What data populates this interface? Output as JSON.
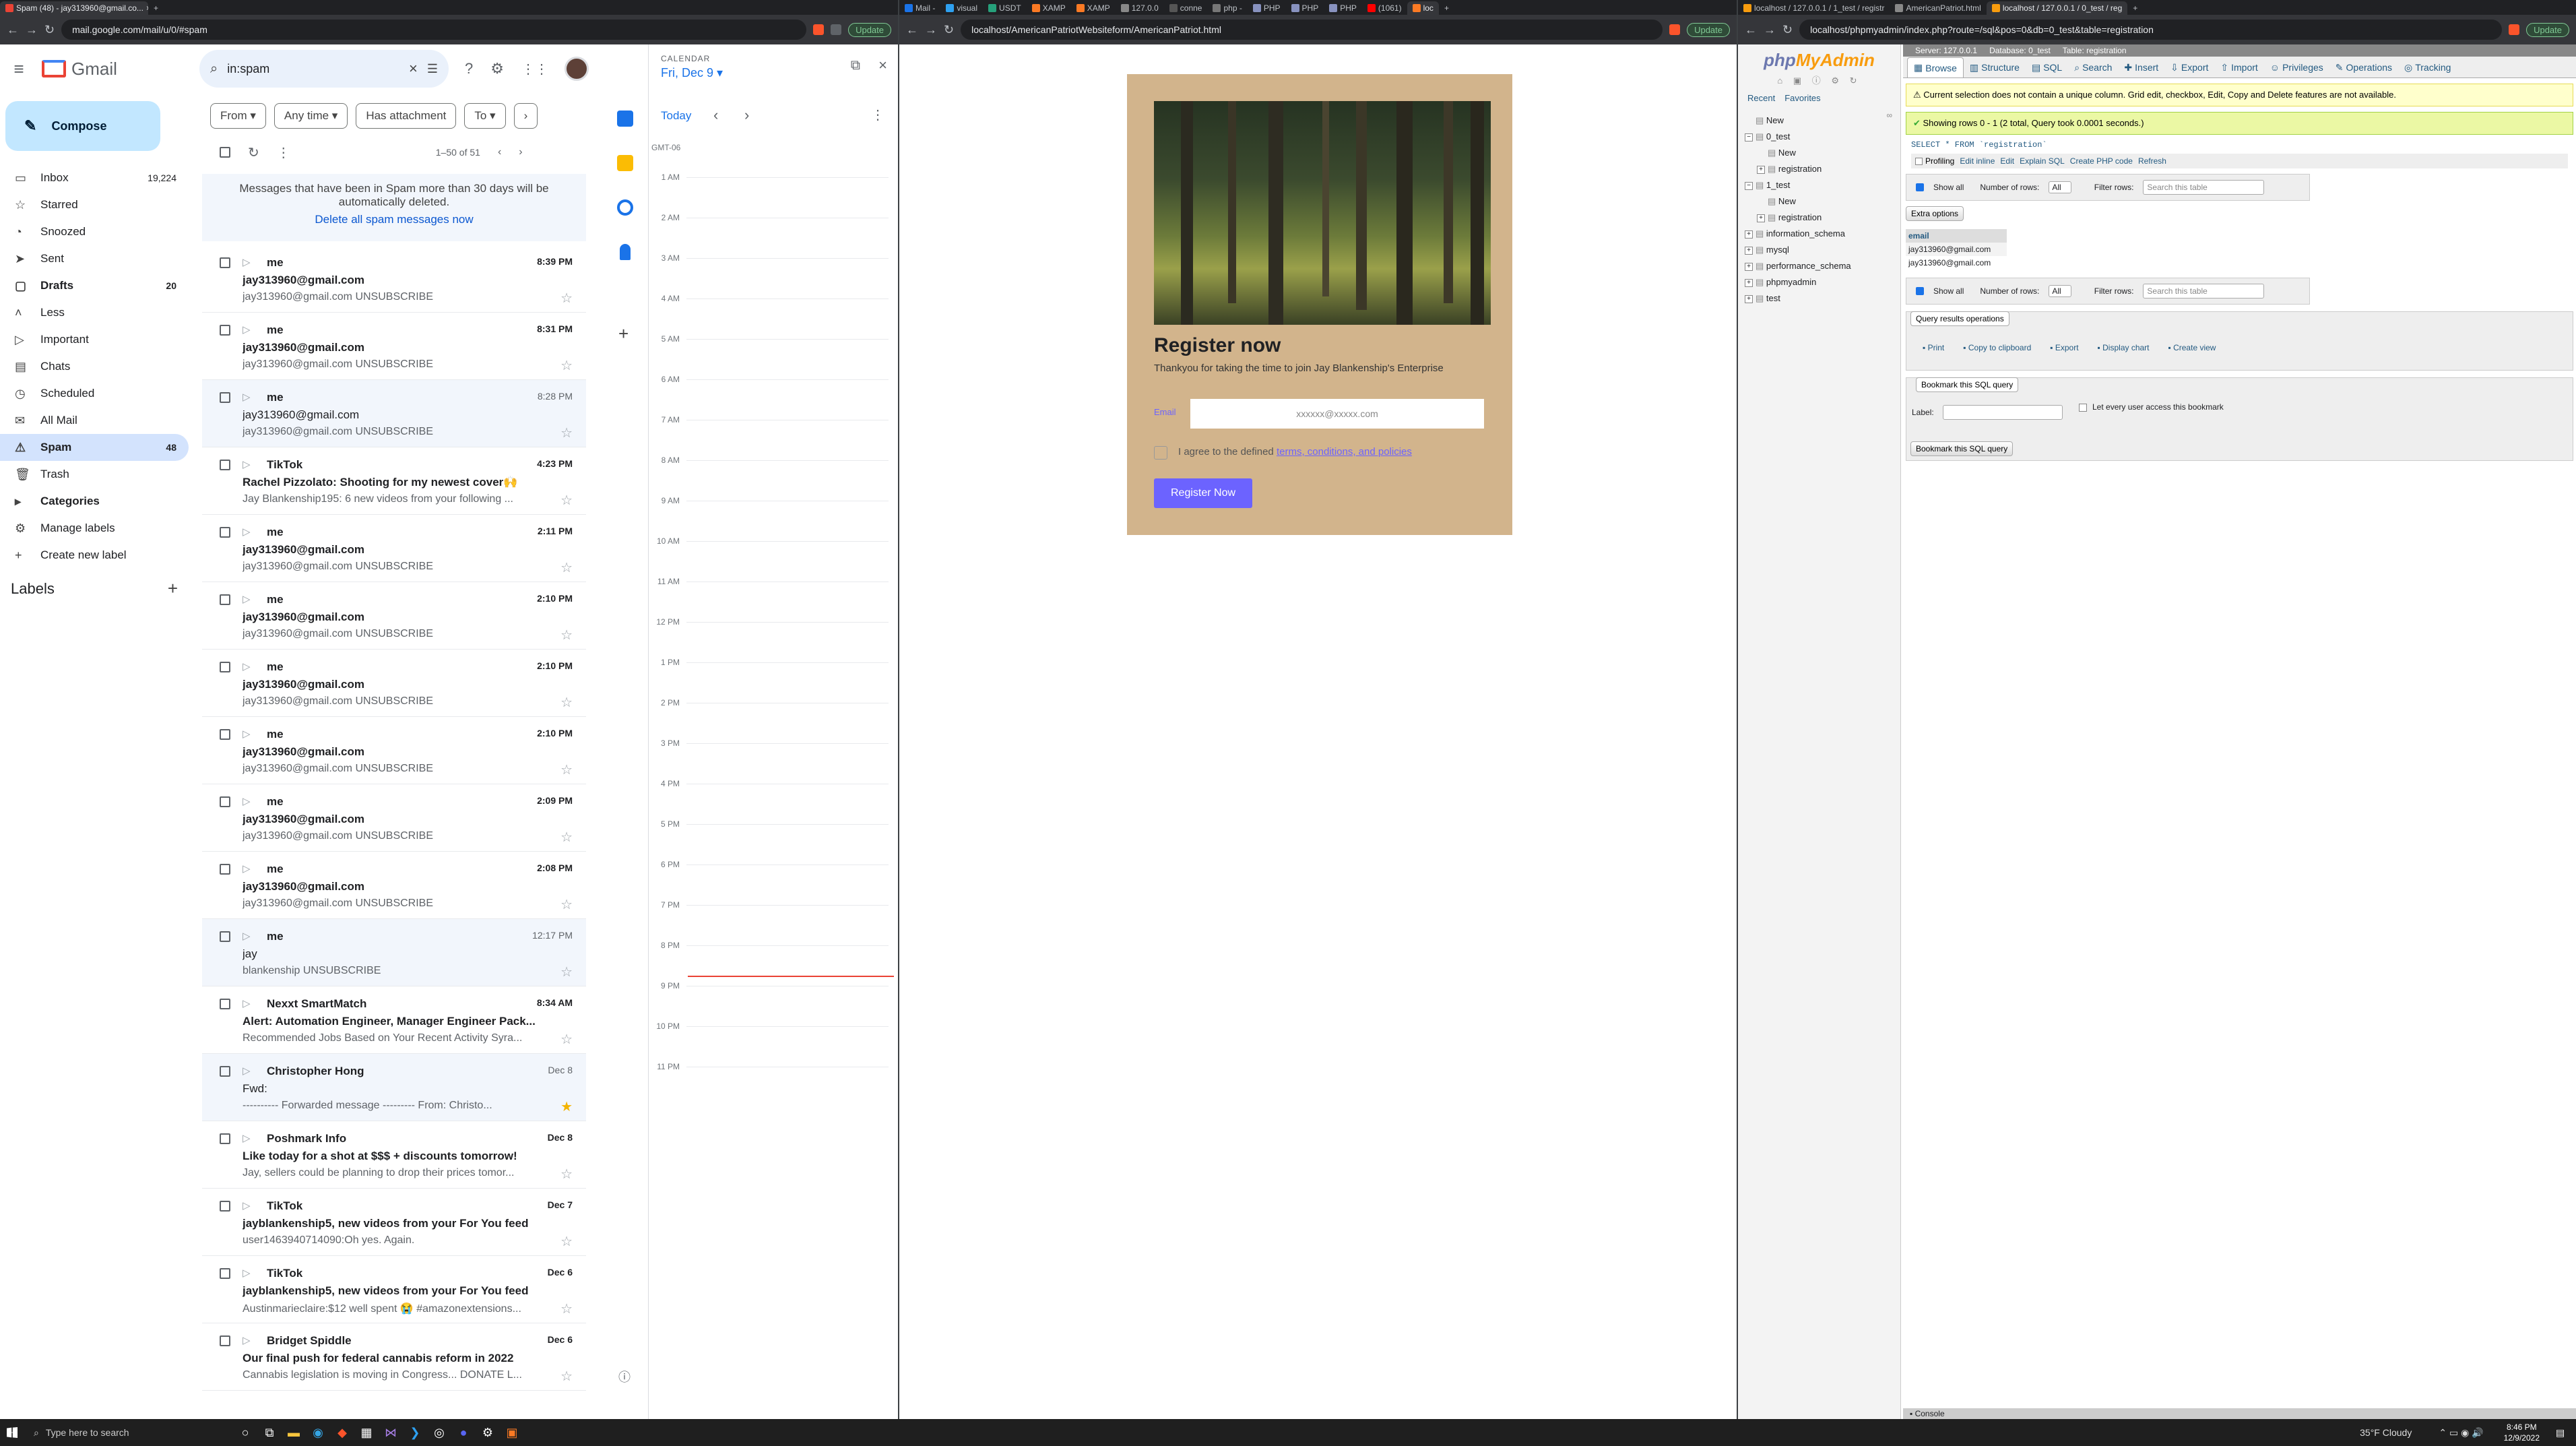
{
  "windows": {
    "gmail": {
      "tab_title": "Spam (48) - jay313960@gmail.co...",
      "url": "mail.google.com/mail/u/0/#spam",
      "update_label": "Update",
      "brand": "Gmail",
      "search_value": "in:spam",
      "compose_label": "Compose",
      "nav": [
        {
          "label": "Inbox",
          "count": "19,224",
          "icon": "inbox-icon",
          "glyph": "▭"
        },
        {
          "label": "Starred",
          "count": "",
          "icon": "star-icon",
          "glyph": "☆"
        },
        {
          "label": "Snoozed",
          "count": "",
          "icon": "clock-icon",
          "glyph": "◔"
        },
        {
          "label": "Sent",
          "count": "",
          "icon": "send-icon",
          "glyph": "➤"
        },
        {
          "label": "Drafts",
          "count": "20",
          "icon": "draft-icon",
          "glyph": "▢"
        },
        {
          "label": "Less",
          "count": "",
          "icon": "chevron-up-icon",
          "glyph": "˄"
        },
        {
          "label": "Important",
          "count": "",
          "icon": "important-icon",
          "glyph": "▷"
        },
        {
          "label": "Chats",
          "count": "",
          "icon": "chat-icon",
          "glyph": "▤"
        },
        {
          "label": "Scheduled",
          "count": "",
          "icon": "scheduled-icon",
          "glyph": "◷"
        },
        {
          "label": "All Mail",
          "count": "",
          "icon": "mail-icon",
          "glyph": "✉"
        },
        {
          "label": "Spam",
          "count": "48",
          "icon": "spam-icon",
          "glyph": "⚠"
        },
        {
          "label": "Trash",
          "count": "",
          "icon": "trash-icon",
          "glyph": "🗑"
        },
        {
          "label": "Categories",
          "count": "",
          "icon": "label-icon",
          "glyph": "▸"
        },
        {
          "label": "Manage labels",
          "count": "",
          "icon": "settings-icon",
          "glyph": "⚙"
        },
        {
          "label": "Create new label",
          "count": "",
          "icon": "plus-icon",
          "glyph": "+"
        }
      ],
      "labels_heading": "Labels",
      "filters": [
        "From ▾",
        "Any time ▾",
        "Has attachment",
        "To ▾"
      ],
      "pagination": "1–50 of 51",
      "spam_notice": "Messages that have been in Spam more than 30 days will be automatically deleted.",
      "delete_spam_link": "Delete all spam messages now",
      "messages": [
        {
          "sender": "me",
          "time": "8:39 PM",
          "subject": "jay313960@gmail.com",
          "snippet": "jay313960@gmail.com UNSUBSCRIBE",
          "read": false,
          "starred": false
        },
        {
          "sender": "me",
          "time": "8:31 PM",
          "subject": "jay313960@gmail.com",
          "snippet": "jay313960@gmail.com UNSUBSCRIBE",
          "read": false,
          "starred": false
        },
        {
          "sender": "me",
          "time": "8:28 PM",
          "subject": "jay313960@gmail.com",
          "snippet": "jay313960@gmail.com UNSUBSCRIBE",
          "read": true,
          "starred": false
        },
        {
          "sender": "TikTok",
          "time": "4:23 PM",
          "subject": "Rachel Pizzolato: Shooting for my newest cover🙌",
          "snippet": "Jay Blankenship195: 6 new videos from your following ...",
          "read": false,
          "starred": false
        },
        {
          "sender": "me",
          "time": "2:11 PM",
          "subject": "jay313960@gmail.com",
          "snippet": "jay313960@gmail.com UNSUBSCRIBE",
          "read": false,
          "starred": false
        },
        {
          "sender": "me",
          "time": "2:10 PM",
          "subject": "jay313960@gmail.com",
          "snippet": "jay313960@gmail.com UNSUBSCRIBE",
          "read": false,
          "starred": false
        },
        {
          "sender": "me",
          "time": "2:10 PM",
          "subject": "jay313960@gmail.com",
          "snippet": "jay313960@gmail.com UNSUBSCRIBE",
          "read": false,
          "starred": false
        },
        {
          "sender": "me",
          "time": "2:10 PM",
          "subject": "jay313960@gmail.com",
          "snippet": "jay313960@gmail.com UNSUBSCRIBE",
          "read": false,
          "starred": false
        },
        {
          "sender": "me",
          "time": "2:09 PM",
          "subject": "jay313960@gmail.com",
          "snippet": "jay313960@gmail.com UNSUBSCRIBE",
          "read": false,
          "starred": false
        },
        {
          "sender": "me",
          "time": "2:08 PM",
          "subject": "jay313960@gmail.com",
          "snippet": "jay313960@gmail.com UNSUBSCRIBE",
          "read": false,
          "starred": false
        },
        {
          "sender": "me",
          "time": "12:17 PM",
          "subject": "jay",
          "snippet": "blankenship UNSUBSCRIBE",
          "read": true,
          "starred": false
        },
        {
          "sender": "Nexxt SmartMatch",
          "time": "8:34 AM",
          "subject": "Alert: Automation Engineer, Manager Engineer Pack...",
          "snippet": "Recommended Jobs Based on Your Recent Activity Syra...",
          "read": false,
          "starred": false
        },
        {
          "sender": "Christopher Hong",
          "time": "Dec 8",
          "subject": "Fwd:",
          "snippet": "---------- Forwarded message --------- From: Christo...",
          "read": true,
          "starred": true
        },
        {
          "sender": "Poshmark Info",
          "time": "Dec 8",
          "subject": "Like today for a shot at $$$ + discounts tomorrow!",
          "snippet": "Jay, sellers could be planning to drop their prices tomor...",
          "read": false,
          "starred": false
        },
        {
          "sender": "TikTok",
          "time": "Dec 7",
          "subject": "jayblankenship5, new videos from your For You feed",
          "snippet": "user1463940714090:Oh yes. Again.",
          "read": false,
          "starred": false
        },
        {
          "sender": "TikTok",
          "time": "Dec 6",
          "subject": "jayblankenship5, new videos from your For You feed",
          "snippet": "Austinmarieclaire:$12 well spent 😭 #amazonextensions...",
          "read": false,
          "starred": false
        },
        {
          "sender": "Bridget Spiddle",
          "time": "Dec 6",
          "subject": "Our final push for federal cannabis reform in 2022",
          "snippet": "Cannabis legislation is moving in Congress... DONATE L...",
          "read": false,
          "starred": false
        }
      ],
      "calendar": {
        "label": "CALENDAR",
        "date": "Fri, Dec 9 ▾",
        "today_label": "Today",
        "timezone": "GMT-06",
        "hours": [
          "1 AM",
          "2 AM",
          "3 AM",
          "4 AM",
          "5 AM",
          "6 AM",
          "7 AM",
          "8 AM",
          "9 AM",
          "10 AM",
          "11 AM",
          "12 PM",
          "1 PM",
          "2 PM",
          "3 PM",
          "4 PM",
          "5 PM",
          "6 PM",
          "7 PM",
          "8 PM",
          "9 PM",
          "10 PM",
          "11 PM"
        ],
        "current_time_fraction": 0.864
      }
    },
    "form": {
      "tabs": [
        "Mail -",
        "visual",
        "USDT",
        "XAMP",
        "XAMP",
        "127.0.0",
        "conne",
        "php -",
        "PHP",
        "PHP",
        "PHP",
        "(1061)",
        "loc"
      ],
      "url": "localhost/AmericanPatriotWebsiteform/AmericanPatriot.html",
      "update_label": "Update",
      "heading": "Register now",
      "subtitle": "Thankyou for taking the time to join Jay Blankenship's Enterprise",
      "email_label": "Email",
      "email_placeholder": "xxxxxx@xxxxx.com",
      "agree_text": "I agree to the defined",
      "terms_link": "terms, conditions, and policies",
      "button": "Register Now"
    },
    "pma": {
      "tabs": [
        "localhost / 127.0.0.1 / 1_test / registr",
        "AmericanPatriot.html",
        "localhost / 127.0.0.1 / 0_test / reg"
      ],
      "url": "localhost/phpmyadmin/index.php?route=/sql&pos=0&db=0_test&table=registration",
      "update_label": "Update",
      "logo_php": "php",
      "logo_my": "MyAdmin",
      "side_tabs": [
        "Recent",
        "Favorites"
      ],
      "tree": [
        {
          "label": "New",
          "level": 0,
          "pm": ""
        },
        {
          "label": "0_test",
          "level": 0,
          "pm": "−"
        },
        {
          "label": "New",
          "level": 1,
          "pm": ""
        },
        {
          "label": "registration",
          "level": 1,
          "pm": "+"
        },
        {
          "label": "1_test",
          "level": 0,
          "pm": "−"
        },
        {
          "label": "New",
          "level": 1,
          "pm": ""
        },
        {
          "label": "registration",
          "level": 1,
          "pm": "+"
        },
        {
          "label": "information_schema",
          "level": 0,
          "pm": "+"
        },
        {
          "label": "mysql",
          "level": 0,
          "pm": "+"
        },
        {
          "label": "performance_schema",
          "level": 0,
          "pm": "+"
        },
        {
          "label": "phpmyadmin",
          "level": 0,
          "pm": "+"
        },
        {
          "label": "test",
          "level": 0,
          "pm": "+"
        }
      ],
      "breadcrumb": [
        "Server: 127.0.0.1",
        "Database: 0_test",
        "Table: registration"
      ],
      "menu": [
        "Browse",
        "Structure",
        "SQL",
        "Search",
        "Insert",
        "Export",
        "Import",
        "Privileges",
        "Operations",
        "Tracking"
      ],
      "warning": "Current selection does not contain a unique column. Grid edit, checkbox, Edit, Copy and Delete features are not available.",
      "success": "Showing rows 0 - 1 (2 total, Query took 0.0001 seconds.)",
      "query": "SELECT * FROM `registration`",
      "query_links": [
        "Profiling",
        "Edit inline",
        "Edit",
        "Explain SQL",
        "Create PHP code",
        "Refresh"
      ],
      "show_all": "Show all",
      "num_rows_label": "Number of rows:",
      "num_rows_value": "All",
      "filter_label": "Filter rows:",
      "filter_placeholder": "Search this table",
      "extra_options": "Extra options",
      "column": "email",
      "rows": [
        "jay313960@gmail.com",
        "jay313960@gmail.com"
      ],
      "qro_title": "Query results operations",
      "qro": [
        "Print",
        "Copy to clipboard",
        "Export",
        "Display chart",
        "Create view"
      ],
      "bookmark_title": "Bookmark this SQL query",
      "bookmark_label": "Label:",
      "bookmark_check": "Let every user access this bookmark",
      "bookmark_button": "Bookmark this SQL query",
      "console": "Console"
    }
  },
  "taskbar": {
    "search_placeholder": "Type here to search",
    "weather": "35°F Cloudy",
    "time": "8:46 PM",
    "date": "12/9/2022"
  }
}
